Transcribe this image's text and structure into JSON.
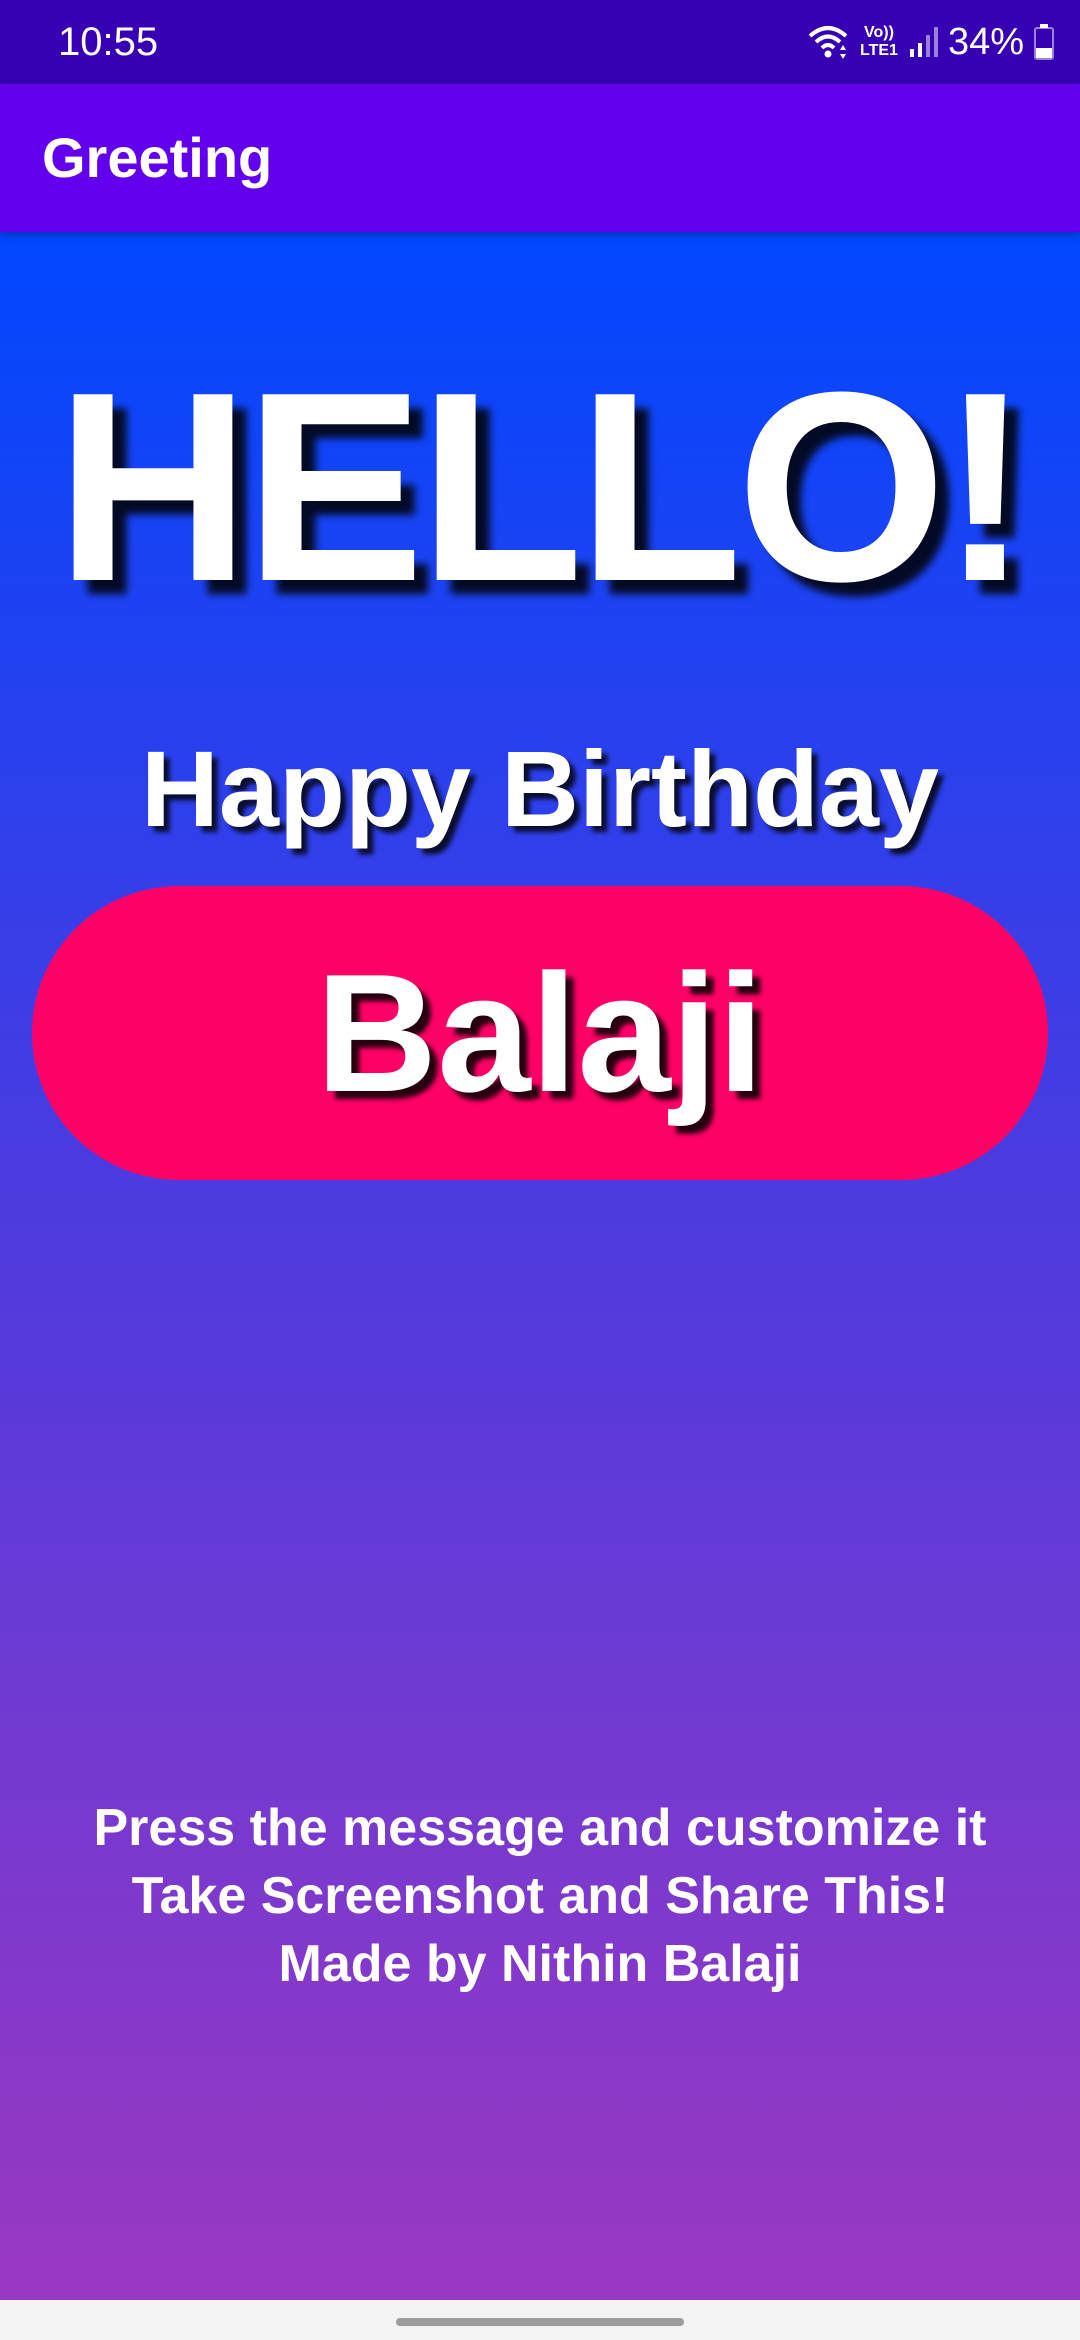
{
  "status_bar": {
    "time": "10:55",
    "network_label_top": "Vo))",
    "network_label_bottom": "LTE1",
    "battery": "34%",
    "icons": [
      "wifi-icon",
      "volte-lte-icon",
      "signal-icon",
      "battery-icon"
    ]
  },
  "app_bar": {
    "title": "Greeting",
    "color": "#6200ee"
  },
  "greeting": {
    "hello": "HELLO!",
    "occasion": "Happy Birthday",
    "name": "Balaji",
    "name_pill_color": "#ff0066"
  },
  "footer": {
    "line1": "Press the message and customize it",
    "line2": "Take Screenshot and Share This!",
    "line3": "Made by Nithin Balaji"
  },
  "colors": {
    "status_bar": "#3700b3",
    "gradient_top": "#0047ff",
    "gradient_bottom": "#9a38c2"
  }
}
